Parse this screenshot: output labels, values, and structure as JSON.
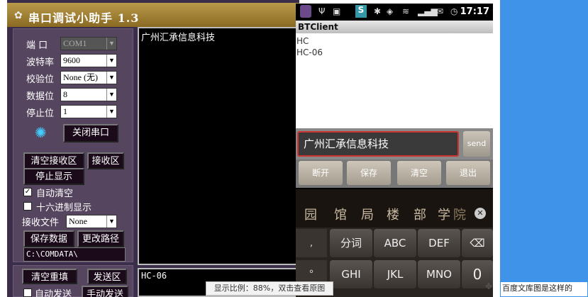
{
  "serial": {
    "title": "串口调试小助手 1.3",
    "port_label": "端  口",
    "port_value": "COM1",
    "baud_label": "波特率",
    "baud_value": "9600",
    "parity_label": "校验位",
    "parity_value": "None (无)",
    "databits_label": "数据位",
    "databits_value": "8",
    "stopbits_label": "停止位",
    "stopbits_value": "1",
    "close_port": "关闭串口",
    "clear_recv": "清空接收区",
    "recv_area": "接收区",
    "stop_display": "停止显示",
    "auto_clear": "自动清空",
    "hex_display": "十六进制显示",
    "recv_file_label": "接收文件",
    "recv_file_value": "None",
    "save_data": "保存数据",
    "change_path": "更改路径",
    "path": "C:\\COMDATA\\",
    "received_text": "广州汇承信息科技",
    "clear_resend": "清空重填",
    "send_area": "发送区",
    "auto_send": "自动发送",
    "manual_send": "手动发送",
    "send_text": "HC-06"
  },
  "phone": {
    "time": "17:17",
    "app_title": "BTClient",
    "devices": [
      "HC",
      "HC-06"
    ],
    "input_text": "广州汇承信息科技",
    "send": "send",
    "buttons": [
      "断开",
      "保存",
      "清空",
      "退出"
    ],
    "candidates": [
      "园",
      "馆",
      "局",
      "楼",
      "部",
      "学",
      "院"
    ],
    "keys_row1": [
      "分词",
      "ABC",
      "DEF"
    ],
    "keys_row2": [
      "GHI",
      "JKL",
      "MNO"
    ],
    "key_zero": "0",
    "key_comma": ",",
    "key_degree": "°"
  },
  "overlay": {
    "tip": "显示比例：88%，双击查看原图",
    "footer": "百度文库图是这样的"
  }
}
